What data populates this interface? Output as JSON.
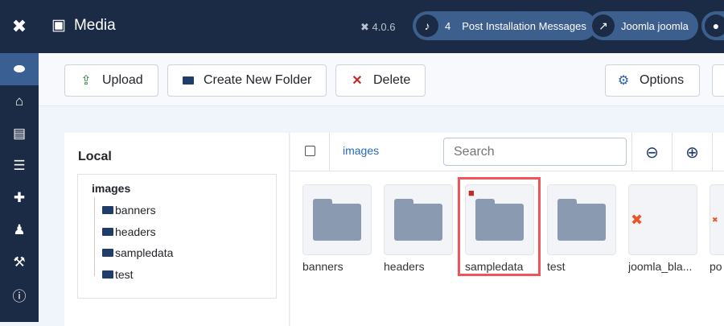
{
  "header": {
    "title": "Media",
    "version": "4.0.6",
    "notifications": {
      "count": "4",
      "label": "Post Installation Messages"
    },
    "site_link": "Joomla joomla"
  },
  "toolbar": {
    "upload": "Upload",
    "new_folder": "Create New Folder",
    "delete": "Delete",
    "options": "Options"
  },
  "tree": {
    "heading": "Local",
    "root": "images",
    "children": [
      "banners",
      "headers",
      "sampledata",
      "test"
    ]
  },
  "browser": {
    "breadcrumb": "images",
    "search_placeholder": "Search",
    "items": [
      {
        "name": "banners",
        "type": "folder"
      },
      {
        "name": "headers",
        "type": "folder"
      },
      {
        "name": "sampledata",
        "type": "folder",
        "locked": true,
        "selected": true
      },
      {
        "name": "test",
        "type": "folder"
      },
      {
        "name": "joomla_bla...",
        "type": "image"
      },
      {
        "name": "po",
        "type": "image"
      }
    ]
  },
  "colors": {
    "sidebar": "#1c2b45",
    "accent": "#3d5f8e",
    "selection": "#f0545a",
    "lock": "#c52827"
  }
}
